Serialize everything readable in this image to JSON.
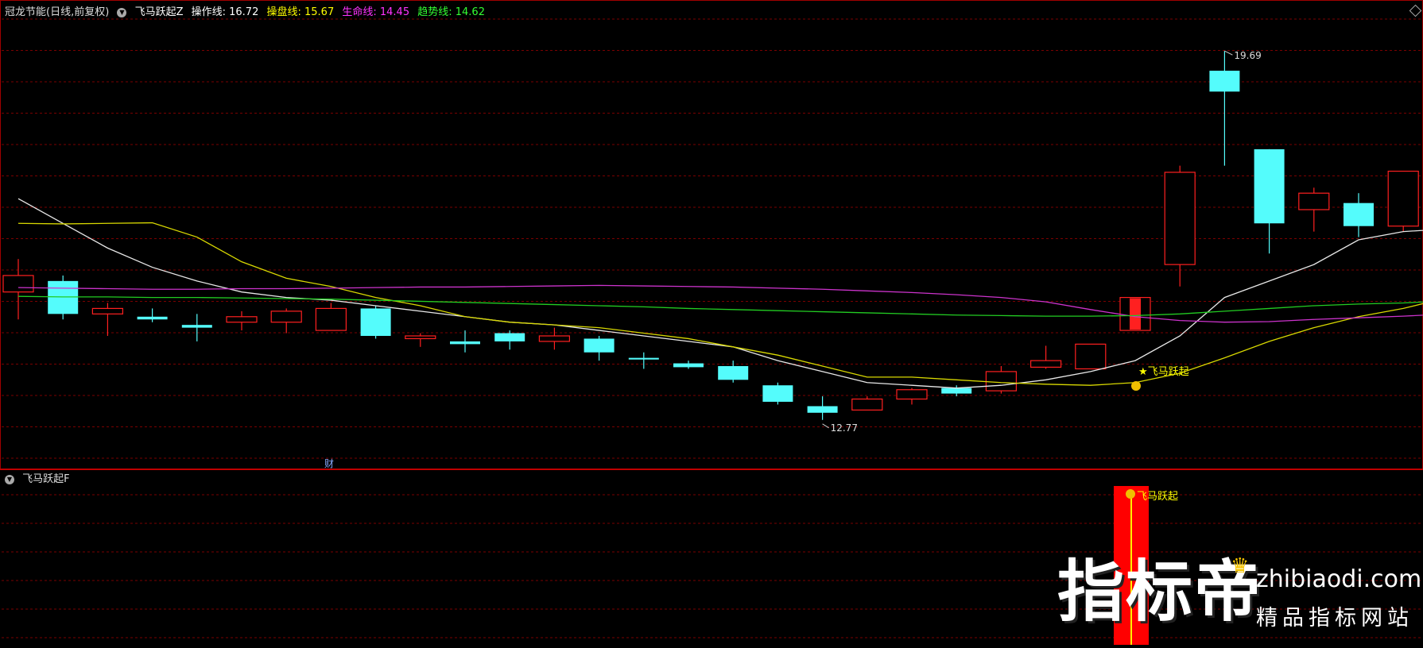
{
  "main_header": {
    "stock": "冠龙节能(日线,前复权)",
    "indicator": "飞马跃起Z",
    "lines": [
      {
        "label": "操作线: 16.72",
        "color": "#ffffff"
      },
      {
        "label": "操盘线: 15.67",
        "color": "#ffff00"
      },
      {
        "label": "生命线: 14.45",
        "color": "#ff33ff"
      },
      {
        "label": "趋势线: 14.62",
        "color": "#33ff33"
      }
    ]
  },
  "sub_header": {
    "indicator": "飞马跃起F"
  },
  "annotations": {
    "high_label": "19.69",
    "low_label": "12.77",
    "signal_label": "飞马跃起",
    "cai_label": "财",
    "signal_sub_label": "飞马跃起"
  },
  "watermark": {
    "big": "指标帝",
    "url": "zhibiaodi.com",
    "sub": "精品指标网站"
  },
  "colors": {
    "up": "#ff2020",
    "down": "#54fcfc",
    "grid": "#7a0000",
    "white_line": "#e8e8e8",
    "yellow_line": "#d8d800",
    "magenta_line": "#cc33cc",
    "green_line": "#22cc22"
  },
  "chart_data": {
    "type": "candlestick",
    "price_range": [
      12.2,
      20.3
    ],
    "candles": [
      {
        "o": 15.3,
        "h": 15.9,
        "l": 14.8,
        "c": 15.6
      },
      {
        "o": 15.5,
        "h": 15.6,
        "l": 14.8,
        "c": 14.9
      },
      {
        "o": 14.9,
        "h": 15.1,
        "l": 14.5,
        "c": 15.0
      },
      {
        "o": 14.85,
        "h": 15.0,
        "l": 14.75,
        "c": 14.8
      },
      {
        "o": 14.7,
        "h": 14.9,
        "l": 14.4,
        "c": 14.65
      },
      {
        "o": 14.75,
        "h": 14.95,
        "l": 14.6,
        "c": 14.85
      },
      {
        "o": 14.75,
        "h": 15.0,
        "l": 14.55,
        "c": 14.95
      },
      {
        "o": 14.6,
        "h": 15.1,
        "l": 14.6,
        "c": 15.0
      },
      {
        "o": 15.0,
        "h": 15.05,
        "l": 14.45,
        "c": 14.5
      },
      {
        "o": 14.45,
        "h": 14.55,
        "l": 14.3,
        "c": 14.5
      },
      {
        "o": 14.4,
        "h": 14.6,
        "l": 14.2,
        "c": 14.35
      },
      {
        "o": 14.55,
        "h": 14.6,
        "l": 14.25,
        "c": 14.4
      },
      {
        "o": 14.4,
        "h": 14.65,
        "l": 14.25,
        "c": 14.5
      },
      {
        "o": 14.45,
        "h": 14.5,
        "l": 14.05,
        "c": 14.2
      },
      {
        "o": 14.1,
        "h": 14.2,
        "l": 13.9,
        "c": 14.07
      },
      {
        "o": 14.0,
        "h": 14.05,
        "l": 13.9,
        "c": 13.93
      },
      {
        "o": 13.95,
        "h": 14.05,
        "l": 13.65,
        "c": 13.7
      },
      {
        "o": 13.6,
        "h": 13.65,
        "l": 13.25,
        "c": 13.3
      },
      {
        "o": 13.22,
        "h": 13.4,
        "l": 12.97,
        "c": 13.1
      },
      {
        "o": 13.15,
        "h": 13.4,
        "l": 13.15,
        "c": 13.35
      },
      {
        "o": 13.35,
        "h": 13.55,
        "l": 13.25,
        "c": 13.52
      },
      {
        "o": 13.55,
        "h": 13.6,
        "l": 13.4,
        "c": 13.45
      },
      {
        "o": 13.5,
        "h": 13.95,
        "l": 13.45,
        "c": 13.85
      },
      {
        "o": 13.93,
        "h": 14.32,
        "l": 13.9,
        "c": 14.05
      },
      {
        "o": 13.9,
        "h": 14.35,
        "l": 13.9,
        "c": 14.35
      },
      {
        "o": 14.6,
        "h": 15.2,
        "l": 14.6,
        "c": 15.2
      },
      {
        "o": 15.8,
        "h": 17.6,
        "l": 15.4,
        "c": 17.48
      },
      {
        "o": 19.33,
        "h": 19.69,
        "l": 17.6,
        "c": 18.95
      },
      {
        "o": 17.9,
        "h": 17.6,
        "l": 16.0,
        "c": 16.55
      },
      {
        "o": 16.8,
        "h": 17.2,
        "l": 16.4,
        "c": 17.1
      },
      {
        "o": 16.92,
        "h": 17.1,
        "l": 16.3,
        "c": 16.5
      },
      {
        "o": 16.5,
        "h": 17.5,
        "l": 16.4,
        "c": 17.5
      }
    ],
    "series": [
      {
        "name": "操作线",
        "values": [
          17.0,
          16.55,
          16.1,
          15.75,
          15.5,
          15.3,
          15.2,
          15.15,
          15.05,
          14.95,
          14.85,
          14.75,
          14.7,
          14.6,
          14.5,
          14.4,
          14.3,
          14.05,
          13.85,
          13.65,
          13.6,
          13.55,
          13.6,
          13.7,
          13.85,
          14.05,
          14.5,
          15.2,
          15.5,
          15.8,
          16.25,
          16.4,
          16.45
        ]
      },
      {
        "name": "操盘线",
        "values": [
          16.55,
          16.54,
          16.55,
          16.56,
          16.3,
          15.85,
          15.55,
          15.4,
          15.2,
          15.05,
          14.85,
          14.75,
          14.7,
          14.65,
          14.55,
          14.45,
          14.3,
          14.15,
          13.95,
          13.75,
          13.75,
          13.7,
          13.65,
          13.62,
          13.6,
          13.65,
          13.82,
          14.1,
          14.4,
          14.65,
          14.85,
          15.0,
          15.2
        ]
      },
      {
        "name": "生命线",
        "values": [
          15.38,
          15.37,
          15.36,
          15.35,
          15.35,
          15.36,
          15.36,
          15.37,
          15.38,
          15.39,
          15.39,
          15.4,
          15.41,
          15.42,
          15.41,
          15.4,
          15.39,
          15.37,
          15.35,
          15.32,
          15.29,
          15.25,
          15.2,
          15.12,
          14.98,
          14.85,
          14.78,
          14.75,
          14.76,
          14.8,
          14.83,
          14.86,
          14.9
        ]
      },
      {
        "name": "趋势线",
        "values": [
          15.22,
          15.21,
          15.21,
          15.2,
          15.2,
          15.19,
          15.18,
          15.17,
          15.15,
          15.13,
          15.11,
          15.09,
          15.07,
          15.05,
          15.03,
          15.0,
          14.98,
          14.96,
          14.94,
          14.92,
          14.9,
          14.88,
          14.87,
          14.86,
          14.86,
          14.87,
          14.9,
          14.95,
          15.0,
          15.05,
          15.08,
          15.1,
          15.14
        ]
      }
    ]
  }
}
